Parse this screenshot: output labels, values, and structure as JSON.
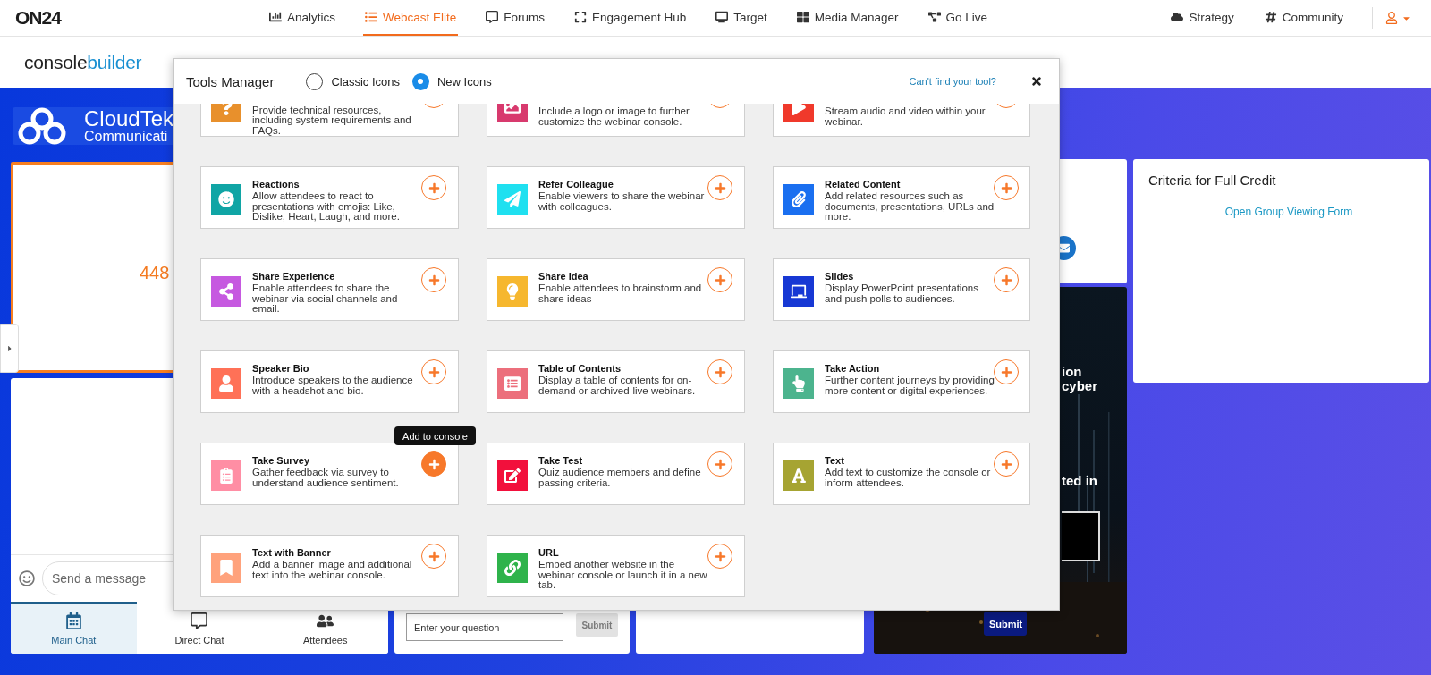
{
  "top_nav": {
    "logo": "ON24",
    "items": [
      {
        "label": "Analytics",
        "selected": false
      },
      {
        "label": "Webcast Elite",
        "selected": true
      },
      {
        "label": "Forums",
        "selected": false
      },
      {
        "label": "Engagement Hub",
        "selected": false
      },
      {
        "label": "Target",
        "selected": false
      },
      {
        "label": "Media Manager",
        "selected": false
      },
      {
        "label": "Go Live",
        "selected": false
      }
    ],
    "right_items": [
      {
        "label": "Strategy"
      },
      {
        "label": "Community"
      }
    ]
  },
  "header": {
    "brand_dark": "console",
    "brand_accent": "builder"
  },
  "console": {
    "banner": {
      "title": "CloudTek",
      "subtitle": "Communicati"
    },
    "counter": {
      "value": "448"
    },
    "chat": {
      "placeholder": "Send a message",
      "tabs": [
        {
          "label": "Main Chat",
          "selected": true
        },
        {
          "label": "Direct Chat",
          "selected": false
        },
        {
          "label": "Attendees",
          "selected": false
        }
      ]
    },
    "qa": {
      "placeholder": "Enter your question",
      "button": "Submit",
      "button_disabled": true
    },
    "promo": {
      "headline": [
        "ion",
        "cyber"
      ],
      "caption": "ted in",
      "button": "Submit"
    },
    "criteria": {
      "title": "Criteria for Full Credit",
      "link": "Open Group Viewing Form"
    }
  },
  "tools_manager": {
    "title": "Tools Manager",
    "options": [
      {
        "label": "Classic Icons",
        "selected": false
      },
      {
        "label": "New Icons",
        "selected": true
      }
    ],
    "help_link": "Can't find your tool?",
    "tools": [
      {
        "description": "Provide technical resources, including system requirements and FAQs.",
        "color": "#e8902c",
        "hovered": false
      },
      {
        "description": "Include a logo or image to further customize the webinar console.",
        "color": "#d83a6e",
        "hovered": false
      },
      {
        "description": "Stream audio and video within your webinar.",
        "color": "#f0392b",
        "hovered": false
      },
      {
        "title": "Reactions",
        "description": "Allow attendees to react to presentations with emojis: Like, Dislike, Heart, Laugh, and more.",
        "color": "#10a5a5",
        "hovered": false
      },
      {
        "title": "Refer Colleague",
        "description": "Enable viewers to share the webinar with colleagues.",
        "color": "#1fe0f0",
        "hovered": false
      },
      {
        "title": "Related Content",
        "description": "Add related resources such as documents, presentations, URLs and more.",
        "color": "#1a6ff0",
        "hovered": false
      },
      {
        "title": "Share Experience",
        "description": "Enable attendees to share the webinar via social channels and email.",
        "color": "#c659e0",
        "hovered": false
      },
      {
        "title": "Share Idea",
        "description": "Enable attendees to brainstorm and share ideas",
        "color": "#f6b72e",
        "hovered": false
      },
      {
        "title": "Slides",
        "description": "Display PowerPoint presentations and push polls to audiences.",
        "color": "#1738d4",
        "hovered": false
      },
      {
        "title": "Speaker Bio",
        "description": "Introduce speakers to the audience with a headshot and bio.",
        "color": "#ff7157",
        "hovered": false
      },
      {
        "title": "Table of Contents",
        "description": "Display a table of contents for on-demand or archived-live webinars.",
        "color": "#ec6f7c",
        "hovered": false
      },
      {
        "title": "Take Action",
        "description": "Further content journeys by providing more content or digital experiences.",
        "color": "#4cb48e",
        "hovered": false
      },
      {
        "title": "Take Survey",
        "description": "Gather feedback via survey to understand audience sentiment.",
        "color": "#ff8ea4",
        "hovered": true,
        "tooltip": "Add to console"
      },
      {
        "title": "Take Test",
        "description": "Quiz audience members and define passing criteria.",
        "color": "#f2103c",
        "hovered": false
      },
      {
        "title": "Text",
        "description": "Add text to customize the console or inform attendees.",
        "color": "#a6a432",
        "hovered": false
      },
      {
        "title": "Text with Banner",
        "description": "Add a banner image and additional text into the webinar console.",
        "color": "#ffa27c",
        "hovered": false
      },
      {
        "title": "URL",
        "description": "Embed another website in the webinar console or launch it in a new tab.",
        "color": "#2fb34b",
        "hovered": false
      }
    ]
  }
}
